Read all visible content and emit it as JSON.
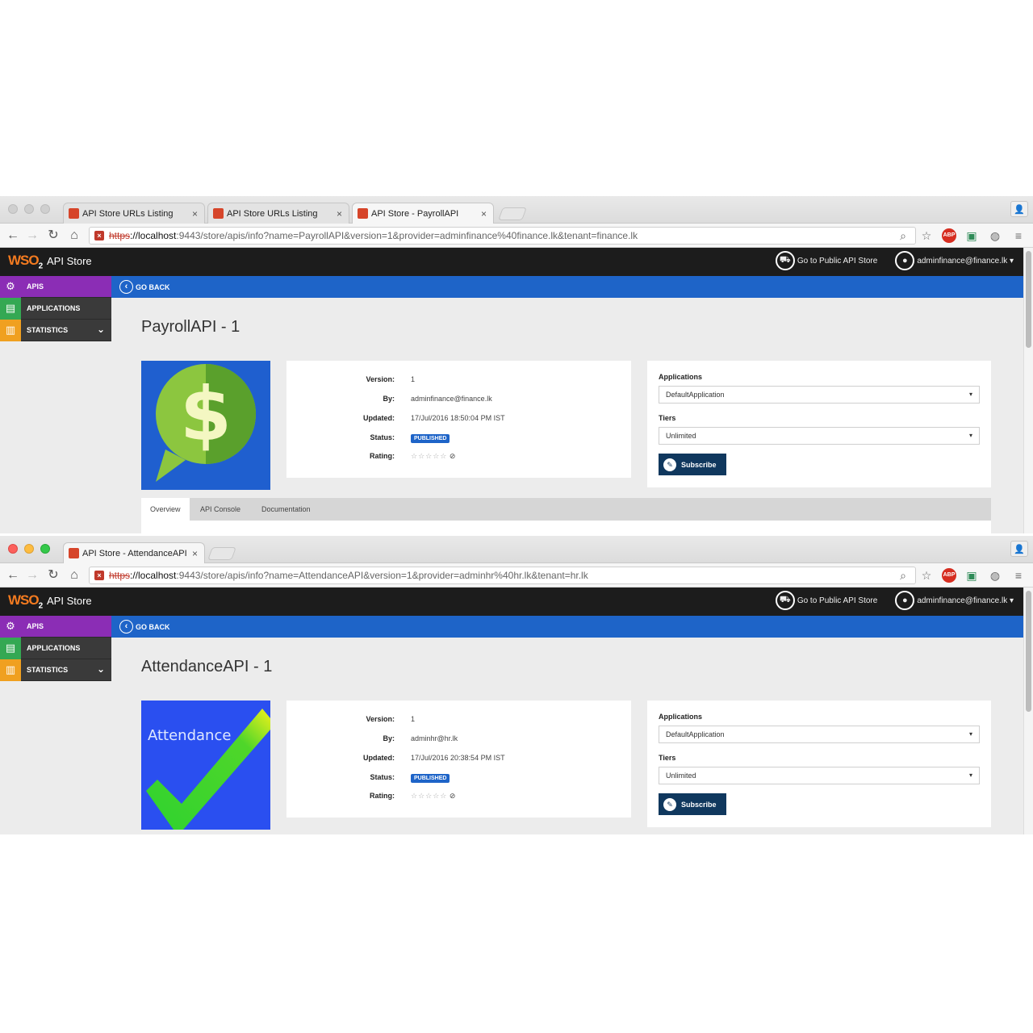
{
  "windows": [
    {
      "tabs": [
        {
          "label": "API Store URLs Listing",
          "close": "×"
        },
        {
          "label": "API Store URLs Listing",
          "close": "×"
        },
        {
          "label": "API Store - PayrollAPI",
          "close": "×"
        }
      ],
      "url": {
        "scheme": "https",
        "host": "://localhost",
        "rest": ":9443/store/apis/info?name=PayrollAPI&version=1&provider=adminfinance%40finance.lk&tenant=finance.lk"
      },
      "app": {
        "logo": "WSO",
        "logo_sub": "2",
        "store_title": "API Store",
        "public_store": "Go to Public API Store",
        "user": "adminfinance@finance.lk ▾",
        "go_back": "GO BACK",
        "sidebar": [
          "APIS",
          "APPLICATIONS",
          "STATISTICS"
        ],
        "api_title": "PayrollAPI - 1",
        "info": {
          "version_label": "Version:",
          "version": "1",
          "by_label": "By:",
          "by": "adminfinance@finance.lk",
          "updated_label": "Updated:",
          "updated": "17/Jul/2016 18:50:04 PM IST",
          "status_label": "Status:",
          "status": "PUBLISHED",
          "rating_label": "Rating:",
          "rating": "☆☆☆☆☆"
        },
        "subscribe": {
          "applications_label": "Applications",
          "application": "DefaultApplication",
          "tiers_label": "Tiers",
          "tier": "Unlimited",
          "button": "Subscribe"
        },
        "content_tabs": [
          "Overview",
          "API Console",
          "Documentation"
        ]
      }
    },
    {
      "tabs": [
        {
          "label": "API Store - AttendanceAPI",
          "close": "×"
        }
      ],
      "url": {
        "scheme": "https",
        "host": "://localhost",
        "rest": ":9443/store/apis/info?name=AttendanceAPI&version=1&provider=adminhr%40hr.lk&tenant=hr.lk"
      },
      "app": {
        "logo": "WSO",
        "logo_sub": "2",
        "store_title": "API Store",
        "public_store": "Go to Public API Store",
        "user": "adminfinance@finance.lk ▾",
        "go_back": "GO BACK",
        "sidebar": [
          "APIS",
          "APPLICATIONS",
          "STATISTICS"
        ],
        "api_title": "AttendanceAPI - 1",
        "thumb_text": "Attendance",
        "info": {
          "version_label": "Version:",
          "version": "1",
          "by_label": "By:",
          "by": "adminhr@hr.lk",
          "updated_label": "Updated:",
          "updated": "17/Jul/2016 20:38:54 PM IST",
          "status_label": "Status:",
          "status": "PUBLISHED",
          "rating_label": "Rating:",
          "rating": "☆☆☆☆☆"
        },
        "subscribe": {
          "applications_label": "Applications",
          "application": "DefaultApplication",
          "tiers_label": "Tiers",
          "tier": "Unlimited",
          "button": "Subscribe"
        }
      }
    }
  ],
  "icons": {
    "back": "←",
    "forward": "→",
    "reload": "↻",
    "home": "⌂",
    "search": "🔍",
    "star": "☆",
    "abp": "ABP",
    "menu": "≡",
    "dollar": "$",
    "chevron": "⌄",
    "caret": "▾"
  },
  "colors": {
    "accent_blue": "#1e64c8",
    "header_black": "#1c1c1c",
    "apis_purple": "#8b2db5",
    "subscribe_navy": "#10385e"
  }
}
